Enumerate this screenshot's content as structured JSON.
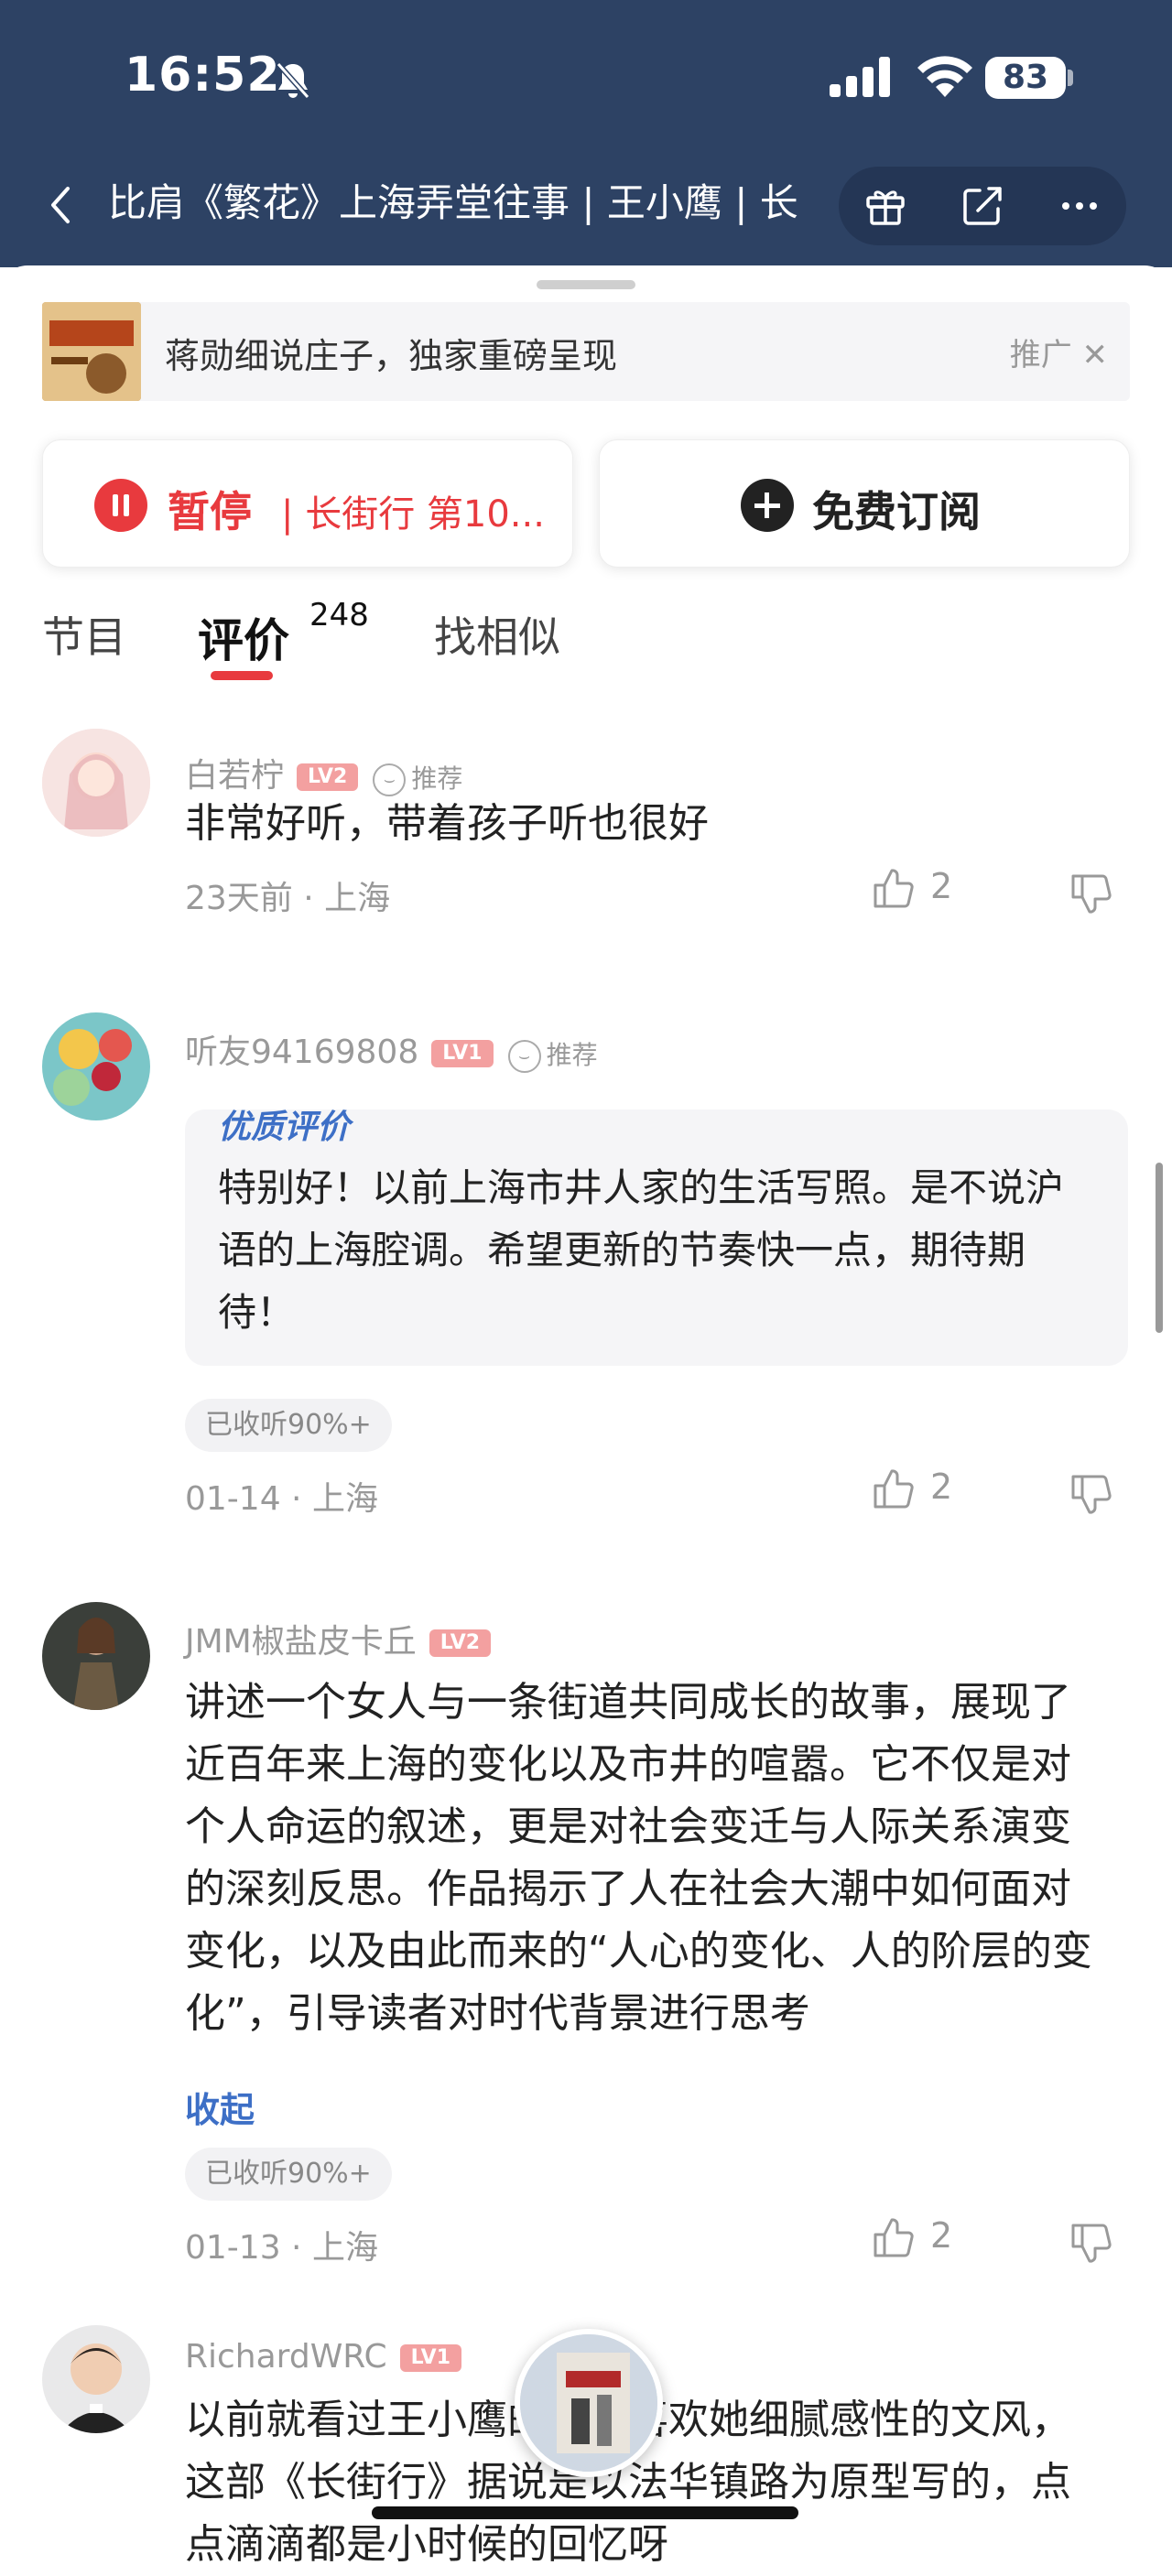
{
  "status": {
    "time": "16:52",
    "battery": "83"
  },
  "nav": {
    "title": "比肩《繁花》上海弄堂往事 | 王小鹰 | 长"
  },
  "ad": {
    "text": "蒋勋细说庄子，独家重磅呈现",
    "tag": "推广 ✕"
  },
  "player": {
    "pause_label": "暂停",
    "now_playing": "| 长街行 第10...",
    "subscribe_label": "免费订阅"
  },
  "tabs": [
    {
      "label": "节目"
    },
    {
      "label": "评价",
      "count": "248"
    },
    {
      "label": "找相似"
    }
  ],
  "reviews": [
    {
      "user": "白若柠",
      "level": "LV2",
      "recommend": "推荐",
      "text": "非常好听，带着孩子听也很好",
      "time": "23天前 · 上海",
      "likes": "2"
    },
    {
      "user": "听友94169808",
      "level": "LV1",
      "recommend": "推荐",
      "quality_tag": "优质评价",
      "text": "特别好！以前上海市井人家的生活写照。是不说沪语的上海腔调。希望更新的节奏快一点，期待期待！",
      "listened": "已收听90%+",
      "time": "01-14 · 上海",
      "likes": "2"
    },
    {
      "user": "JMM椒盐皮卡丘",
      "level": "LV2",
      "text": "讲述一个女人与一条街道共同成长的故事，展现了近百年来上海的变化以及市井的喧嚣。它不仅是对个人命运的叙述，更是对社会变迁与人际关系演变的深刻反思。作品揭示了人在社会大潮中如何面对变化，以及由此而来的“人心的变化、人的阶层的变化”，引导读者对时代背景进行思考",
      "collapse": "收起",
      "listened": "已收听90%+",
      "time": "01-13 · 上海",
      "likes": "2"
    },
    {
      "user": "RichardWRC",
      "level": "LV1",
      "text": "以前就看过王小鹰的书，喜欢她细腻感性的文风，这部《长街行》据说是以法华镇路为原型写的，点点滴滴都是小时候的回忆呀"
    }
  ],
  "colors": {
    "header": "#2d4264",
    "accent": "#e83a3e",
    "link": "#3d6fc6"
  }
}
